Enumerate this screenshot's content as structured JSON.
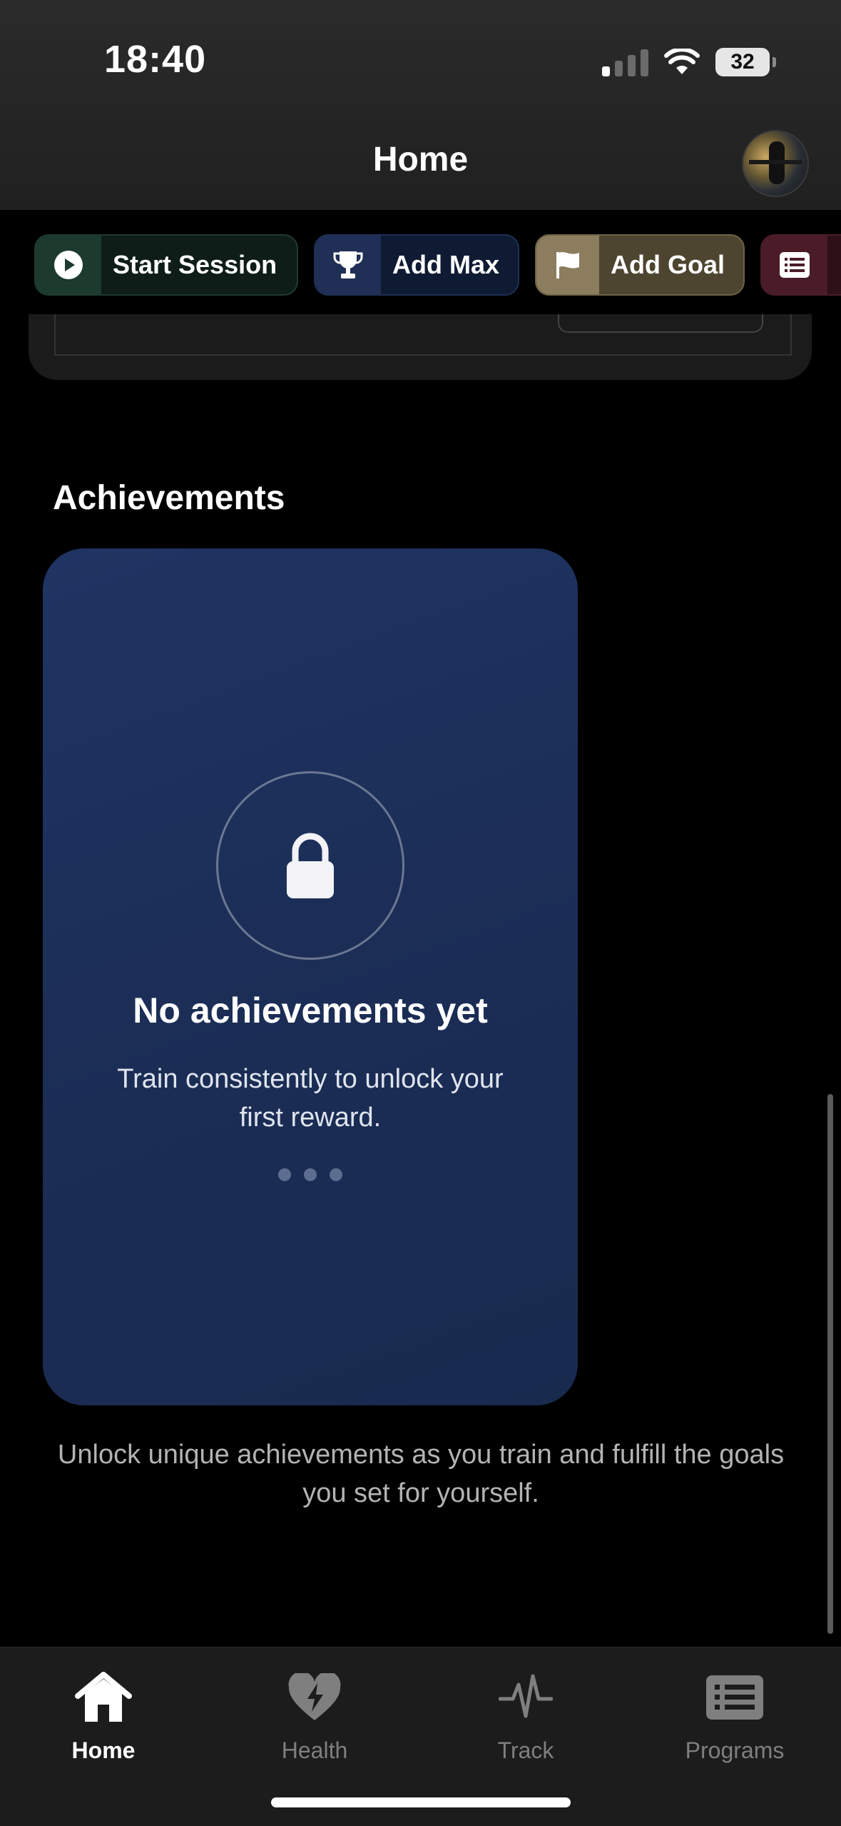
{
  "status_bar": {
    "time": "18:40",
    "battery": "32"
  },
  "header": {
    "title": "Home"
  },
  "actions": [
    {
      "label": "Start Session",
      "icon": "play-icon"
    },
    {
      "label": "Add Max",
      "icon": "trophy-icon"
    },
    {
      "label": "Add Goal",
      "icon": "flag-icon"
    },
    {
      "label": "",
      "icon": "list-icon"
    }
  ],
  "achievements": {
    "section_title": "Achievements",
    "empty_title": "No achievements yet",
    "empty_subtitle": "Train consistently to unlock your first reward.",
    "footnote": "Unlock unique achievements as you train and fulfill the goals you set for yourself."
  },
  "tabbar": {
    "items": [
      {
        "label": "Home",
        "icon": "house-icon",
        "active": true
      },
      {
        "label": "Health",
        "icon": "heart-bolt-icon",
        "active": false
      },
      {
        "label": "Track",
        "icon": "pulse-icon",
        "active": false
      },
      {
        "label": "Programs",
        "icon": "list-board-icon",
        "active": false
      }
    ]
  },
  "colors": {
    "card_blue": "#1f3462",
    "chip_green": "#1c3a2d",
    "chip_navy": "#1f2f55",
    "chip_gold": "#8b7d5e",
    "chip_maroon": "#4a1c28"
  }
}
